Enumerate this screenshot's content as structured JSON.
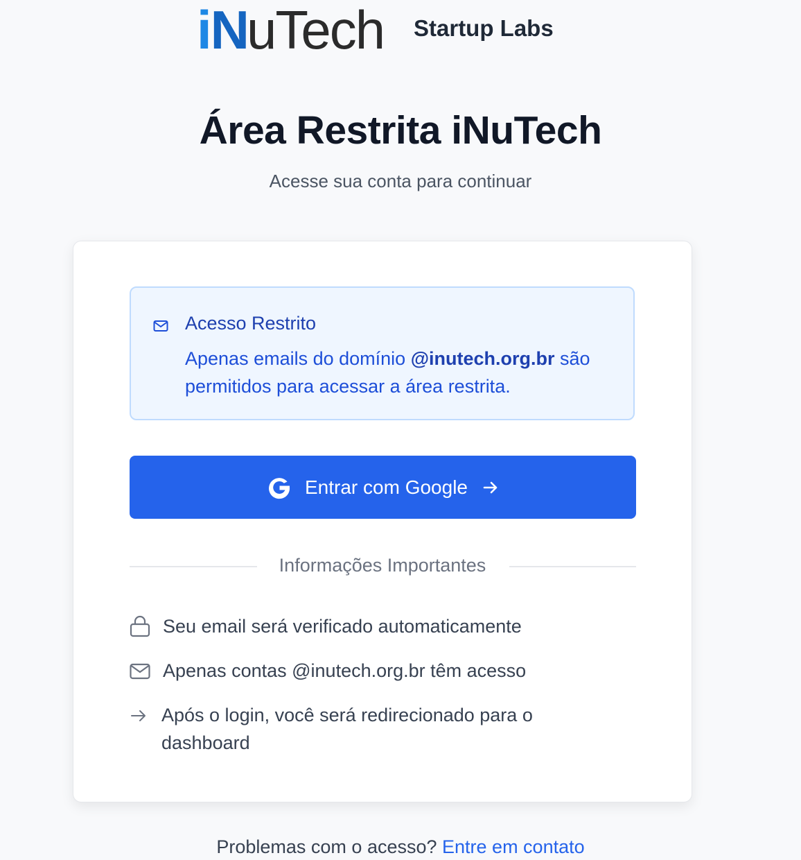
{
  "brand": {
    "logo_i": "i",
    "logo_n": "N",
    "logo_rest": "uTech",
    "subtitle": "Startup Labs"
  },
  "page": {
    "title": "Área Restrita iNuTech",
    "subtitle": "Acesse sua conta para continuar"
  },
  "notice": {
    "icon": "mail-icon",
    "title": "Acesso Restrito",
    "text_before": "Apenas emails do domínio ",
    "domain": "@inutech.org.br",
    "text_after": " são permitidos para acessar a área restrita."
  },
  "login": {
    "google_label": "Entrar com Google",
    "google_icon": "google-icon",
    "arrow_icon": "arrow-right-icon"
  },
  "info": {
    "heading": "Informações Importantes",
    "items": [
      {
        "icon": "lock-icon",
        "text": "Seu email será verificado automaticamente"
      },
      {
        "icon": "mail-icon",
        "text": "Apenas contas @inutech.org.br têm acesso"
      },
      {
        "icon": "arrow-right-icon",
        "text": "Após o login, você será redirecionado para o dashboard"
      }
    ]
  },
  "footer": {
    "question": "Problemas com o acesso? ",
    "link": "Entre em contato"
  },
  "colors": {
    "primary": "#2563eb",
    "notice_bg": "#eff6ff",
    "notice_border": "#bfdbfe",
    "notice_text": "#1d4ed8"
  }
}
